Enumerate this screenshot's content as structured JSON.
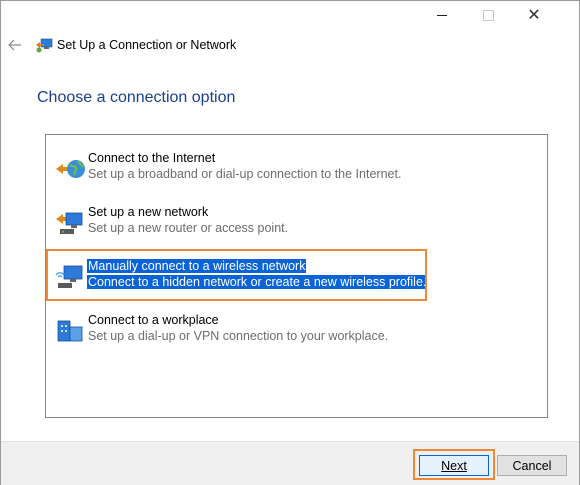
{
  "window": {
    "title": "Set Up a Connection or Network",
    "controls": {
      "minimize": "—",
      "maximize": "☐",
      "close": "✕"
    }
  },
  "heading": "Choose a connection option",
  "options": [
    {
      "title": "Connect to the Internet",
      "description": "Set up a broadband or dial-up connection to the Internet.",
      "icon": "internet-globe-icon"
    },
    {
      "title": "Set up a new network",
      "description": "Set up a new router or access point.",
      "icon": "router-icon"
    },
    {
      "title": "Manually connect to a wireless network",
      "description": "Connect to a hidden network or create a new wireless profile.",
      "icon": "wireless-network-icon",
      "selected": true
    },
    {
      "title": "Connect to a workplace",
      "description": "Set up a dial-up or VPN connection to your workplace.",
      "icon": "workplace-icon"
    }
  ],
  "buttons": {
    "next": "Next",
    "cancel": "Cancel"
  },
  "colors": {
    "heading": "#1b3f91",
    "selection": "#0a64d8",
    "highlight": "#f0883a"
  }
}
